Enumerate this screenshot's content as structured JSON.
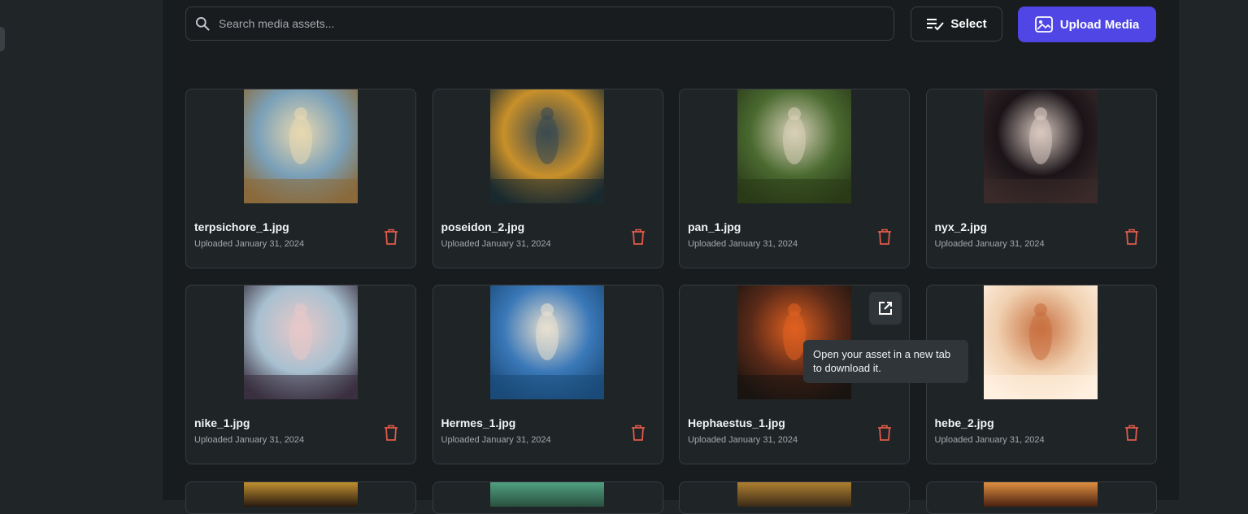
{
  "search": {
    "placeholder": "Search media assets...",
    "icon": "search-icon"
  },
  "toolbar": {
    "select_label": "Select",
    "upload_label": "Upload Media",
    "accent": "#4f46e5"
  },
  "assets": [
    {
      "name": "terpsichore_1.jpg",
      "date": "Uploaded January 31, 2024",
      "palette": [
        "#7aa0b8",
        "#e8d8b0",
        "#8a6a3a"
      ]
    },
    {
      "name": "poseidon_2.jpg",
      "date": "Uploaded January 31, 2024",
      "palette": [
        "#c8902a",
        "#3a4a50",
        "#1a2a30"
      ]
    },
    {
      "name": "pan_1.jpg",
      "date": "Uploaded January 31, 2024",
      "palette": [
        "#4a6a30",
        "#d8d0b8",
        "#2a3a18"
      ]
    },
    {
      "name": "nyx_2.jpg",
      "date": "Uploaded January 31, 2024",
      "palette": [
        "#1a1418",
        "#d8c8c0",
        "#3a2a2a"
      ]
    },
    {
      "name": "nike_1.jpg",
      "date": "Uploaded January 31, 2024",
      "palette": [
        "#a8c0d0",
        "#e8c8c8",
        "#3a3040"
      ]
    },
    {
      "name": "Hermes_1.jpg",
      "date": "Uploaded January 31, 2024",
      "palette": [
        "#3a78b8",
        "#e8e0d0",
        "#1a4a78"
      ]
    },
    {
      "name": "Hephaestus_1.jpg",
      "date": "Uploaded January 31, 2024",
      "palette": [
        "#5a2a18",
        "#e06020",
        "#1a1410"
      ]
    },
    {
      "name": "hebe_2.jpg",
      "date": "Uploaded January 31, 2024",
      "palette": [
        "#f0d0b0",
        "#c87040",
        "#fff0e0"
      ]
    }
  ],
  "peek_palettes": [
    [
      "#c09030",
      "#2a1a10"
    ],
    [
      "#50a080",
      "#2a5040"
    ],
    [
      "#b08030",
      "#3a2a18"
    ],
    [
      "#e09040",
      "#4a2010"
    ]
  ],
  "tooltip": {
    "text": "Open your asset in a new tab to download it."
  },
  "colors": {
    "delete": "#e05a4a"
  }
}
